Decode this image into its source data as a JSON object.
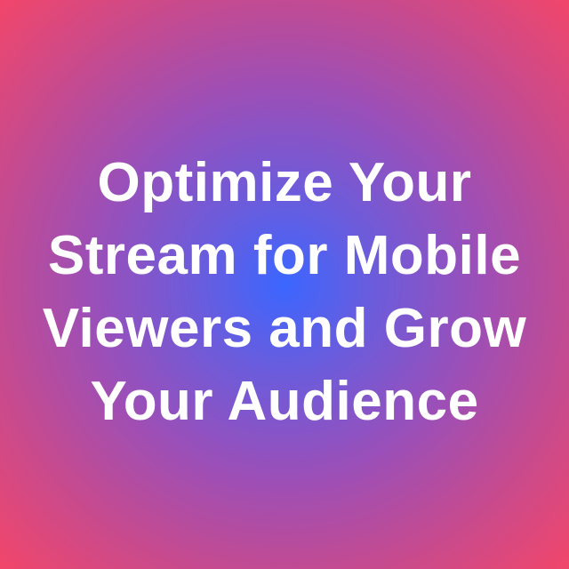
{
  "headline": {
    "lines": [
      "Optimize Your",
      "Stream for Mobile",
      "Viewers and Grow",
      "Your Audience"
    ]
  },
  "colors": {
    "center": "#3b66ff",
    "edge": "#f2466a",
    "text": "#ffffff"
  }
}
